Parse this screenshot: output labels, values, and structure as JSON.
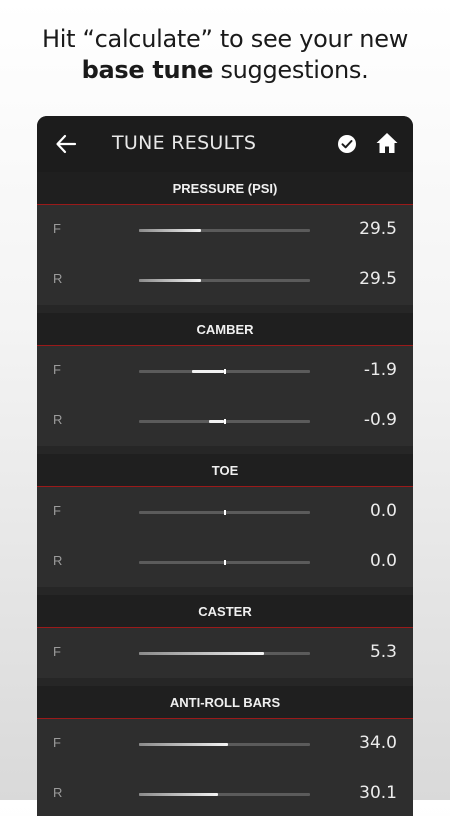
{
  "caption": {
    "line1": "Hit “calculate” to see your new",
    "bold": "base tune",
    "rest": " suggestions."
  },
  "appbar": {
    "title": "TUNE RESULTS",
    "icons": [
      "back-arrow-icon",
      "check-circle-icon",
      "home-icon"
    ]
  },
  "sections": [
    {
      "title": "PRESSURE (PSI)",
      "rows": [
        {
          "label": "F",
          "value": "29.5",
          "level": 0.36,
          "centered": false
        },
        {
          "label": "R",
          "value": "29.5",
          "level": 0.36,
          "centered": false
        }
      ]
    },
    {
      "title": "CAMBER",
      "rows": [
        {
          "label": "F",
          "value": "-1.9",
          "level": -0.19,
          "centered": true
        },
        {
          "label": "R",
          "value": "-0.9",
          "level": -0.09,
          "centered": true
        }
      ]
    },
    {
      "title": "TOE",
      "rows": [
        {
          "label": "F",
          "value": "0.0",
          "level": 0.0,
          "centered": true
        },
        {
          "label": "R",
          "value": "0.0",
          "level": 0.0,
          "centered": true
        }
      ]
    },
    {
      "title": "CASTER",
      "rows": [
        {
          "label": "F",
          "value": "5.3",
          "level": 0.73,
          "centered": false
        }
      ]
    },
    {
      "title": "ANTI-ROLL BARS",
      "rows": [
        {
          "label": "F",
          "value": "34.0",
          "level": 0.52,
          "centered": false
        },
        {
          "label": "R",
          "value": "30.1",
          "level": 0.46,
          "centered": false
        }
      ]
    }
  ],
  "colors": {
    "appbar": "#1c1c1c",
    "panel": "#2e2e2e",
    "section_header": "#1f1f1f",
    "accent_line": "#9a1a1a",
    "slider_fill": "#f2f2f2",
    "slider_track": "#5b5b5b"
  }
}
